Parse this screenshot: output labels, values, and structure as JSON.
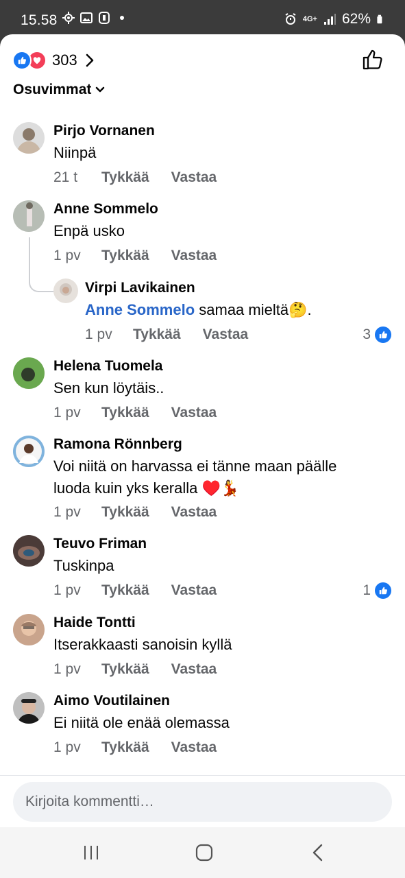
{
  "status": {
    "time": "15.58",
    "network": "4G+",
    "battery": "62%"
  },
  "reactions": {
    "count": "303"
  },
  "sort": {
    "label": "Osuvimmat"
  },
  "comments": [
    {
      "name": "Pirjo Vornanen",
      "text": "Niinpä",
      "time": "21 t",
      "like": "Tykkää",
      "reply": "Vastaa",
      "avatar_color": "#8a7a6a"
    },
    {
      "name": "Anne Sommelo",
      "text": "Enpä usko",
      "time": "1 pv",
      "like": "Tykkää",
      "reply": "Vastaa",
      "avatar_color": "#9aa09a"
    },
    {
      "name": "Virpi Lavikainen",
      "mention": "Anne Sommelo",
      "text": " samaa mieltä🤔.",
      "time": "1 pv",
      "like": "Tykkää",
      "reply": "Vastaa",
      "likes": "3",
      "avatar_color": "#d9d2cc"
    },
    {
      "name": "Helena Tuomela",
      "text": "Sen kun löytäis..",
      "time": "1 pv",
      "like": "Tykkää",
      "reply": "Vastaa",
      "avatar_color": "#4f8a3a"
    },
    {
      "name": "Ramona Rönnberg",
      "text": "Voi niitä on harvassa ei tänne maan päälle luoda kuin yks keralla ♥️💃",
      "time": "1 pv",
      "like": "Tykkää",
      "reply": "Vastaa",
      "avatar_color": "#5a9fd0"
    },
    {
      "name": "Teuvo Friman",
      "text": "Tuskinpa",
      "time": "1 pv",
      "like": "Tykkää",
      "reply": "Vastaa",
      "likes": "1",
      "avatar_color": "#6b5a55"
    },
    {
      "name": "Haide Tontti",
      "text": "Itserakkaasti sanoisin kyllä",
      "time": "1 pv",
      "like": "Tykkää",
      "reply": "Vastaa",
      "avatar_color": "#b0836a"
    },
    {
      "name": "Aimo Voutilainen",
      "text": "Ei niitä ole enää olemassa",
      "time": "1 pv",
      "like": "Tykkää",
      "reply": "Vastaa",
      "avatar_color": "#3a3a3a"
    }
  ],
  "composer": {
    "placeholder": "Kirjoita kommentti…"
  },
  "colors": {
    "accent": "#1877f2",
    "love": "#f33e58",
    "mention": "#2966c8",
    "meta": "#65676b"
  }
}
